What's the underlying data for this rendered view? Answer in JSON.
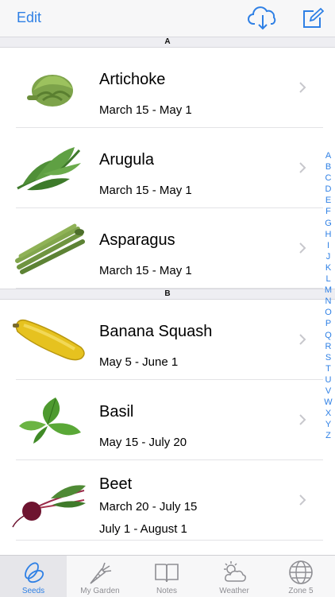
{
  "navbar": {
    "edit_label": "Edit",
    "cloud_icon": "cloud-download-icon",
    "compose_icon": "compose-icon"
  },
  "sections": [
    {
      "letter": "A",
      "items": [
        {
          "name": "Artichoke",
          "dates": [
            "March 15 - May 1"
          ]
        },
        {
          "name": "Arugula",
          "dates": [
            "March 15 - May 1"
          ]
        },
        {
          "name": "Asparagus",
          "dates": [
            "March 15 - May 1"
          ]
        }
      ]
    },
    {
      "letter": "B",
      "items": [
        {
          "name": "Banana Squash",
          "dates": [
            "May 5 - June 1"
          ]
        },
        {
          "name": "Basil",
          "dates": [
            "May 15 - July 20"
          ]
        },
        {
          "name": "Beet",
          "dates": [
            "March 20 - July 15",
            "July 1 - August 1"
          ]
        }
      ]
    }
  ],
  "index_letters": [
    "A",
    "B",
    "C",
    "D",
    "E",
    "F",
    "G",
    "H",
    "I",
    "J",
    "K",
    "L",
    "M",
    "N",
    "O",
    "P",
    "Q",
    "R",
    "S",
    "T",
    "U",
    "V",
    "W",
    "X",
    "Y",
    "Z"
  ],
  "tabs": [
    {
      "label": "Seeds",
      "icon": "seeds-icon",
      "active": true
    },
    {
      "label": "My Garden",
      "icon": "carrot-icon",
      "active": false
    },
    {
      "label": "Notes",
      "icon": "book-icon",
      "active": false
    },
    {
      "label": "Weather",
      "icon": "weather-icon",
      "active": false
    },
    {
      "label": "Zone 5",
      "icon": "globe-icon",
      "active": false
    }
  ],
  "colors": {
    "accent": "#2f80e5",
    "tab_inactive": "#8e8e93"
  }
}
